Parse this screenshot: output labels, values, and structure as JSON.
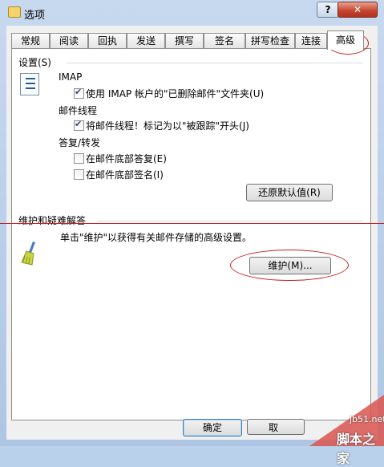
{
  "window": {
    "title": "选项",
    "help": "?",
    "close": "✕"
  },
  "tabs": [
    "常规",
    "阅读",
    "回执",
    "发送",
    "撰写",
    "签名",
    "拼写检查",
    "连接",
    "高级"
  ],
  "active_tab": "高级",
  "settings": {
    "group_label": "设置(S)",
    "imap": {
      "heading": "IMAP",
      "checkbox_label": "使用 IMAP 帐户的\"已删除邮件\"文件夹(U)",
      "checked": true
    },
    "threads": {
      "heading": "邮件线程",
      "checkbox_label": "将邮件线程！标记为以\"被跟踪\"开头(J)",
      "checked": true
    },
    "reply": {
      "heading": "答复/转发",
      "reply_bottom_label": "在邮件底部答复(E)",
      "reply_bottom_checked": false,
      "sign_bottom_label": "在邮件底部签名(I)",
      "sign_bottom_checked": false
    },
    "restore_button": "还原默认值(R)"
  },
  "maintenance": {
    "group_label": "维护和疑难解答",
    "description": "单击\"维护\"以获得有关邮件存储的高级设置。",
    "button": "维护(M)..."
  },
  "footer": {
    "ok": "确定",
    "cancel": "取"
  },
  "watermark": {
    "site": "jb51.net",
    "brand": "脚本之家"
  },
  "colors": {
    "annotation": "#c81e1e"
  }
}
